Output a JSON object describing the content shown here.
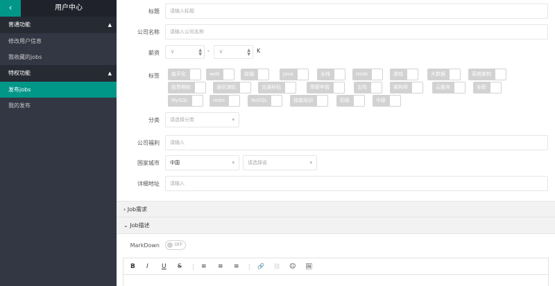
{
  "sidebar": {
    "back_icon": "‹",
    "title": "用户中心",
    "group1": {
      "label": "普通功能",
      "items": [
        "修改用户信息",
        "我收藏的jobs"
      ]
    },
    "group2": {
      "label": "特权功能",
      "items": [
        "发布jobs",
        "我的发布"
      ],
      "active_index": 0
    }
  },
  "form": {
    "title": {
      "label": "标题",
      "placeholder": "请输入标题"
    },
    "company": {
      "label": "公司名称",
      "placeholder": "请输入公司名称"
    },
    "salary": {
      "label": "薪资",
      "min_placeholder": "￥",
      "dash": "-",
      "max_placeholder": "￥",
      "unit": "K"
    },
    "tags": {
      "label": "标签",
      "items": [
        "扁平化",
        "web",
        "前端",
        "Java",
        "全栈",
        "node",
        "游戏",
        "大数据",
        "系统架构",
        "股票期权",
        "通讯津贴",
        "交通补贴",
        "带薪年假",
        "五险",
        "架构师",
        "云服务",
        "全职",
        "MySQL",
        "redis",
        "NoSQL",
        "技能培训",
        "初级",
        "中级"
      ]
    },
    "category": {
      "label": "分类",
      "placeholder": "请选择分类"
    },
    "benefits": {
      "label": "公司福利",
      "placeholder": "请输入"
    },
    "location": {
      "label": "国家城市",
      "country": "中国",
      "city_placeholder": "请选择省"
    },
    "address": {
      "label": "详细地址",
      "placeholder": "请输入"
    }
  },
  "sections": {
    "job_requirements": "Job需求",
    "job_description": "Job描述"
  },
  "markdown": {
    "label": "MarkDown",
    "state": "OFF"
  },
  "toolbar": {
    "bold": "B",
    "italic": "I",
    "underline": "U",
    "strike": "S",
    "align_left": "≡",
    "align_center": "≡",
    "align_right": "≡",
    "link": "🔗",
    "unlink": "⛓",
    "emoji": "☺",
    "image": "🖼"
  },
  "colors": {
    "sidebar_bg": "#333744",
    "accent": "#009688",
    "tag_bg": "#d2d2d2"
  }
}
